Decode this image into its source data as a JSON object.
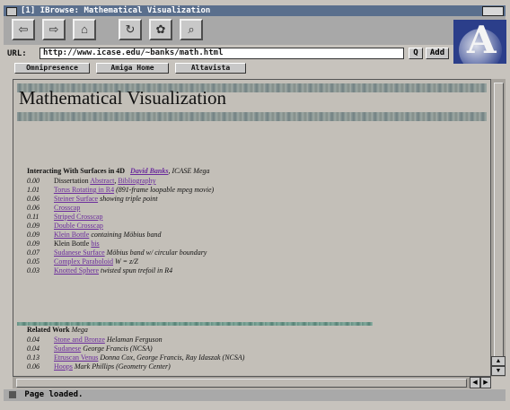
{
  "window": {
    "title": "[1] IBrowse: Mathematical Visualization"
  },
  "toolbar": {
    "buttons": [
      {
        "name": "back-button",
        "label": "⇦",
        "icon": "back-arrow-icon"
      },
      {
        "name": "forward-button",
        "label": "⇨",
        "icon": "forward-arrow-icon"
      },
      {
        "name": "home-button",
        "label": "⌂",
        "icon": "home-icon"
      },
      {
        "name": "reload-button",
        "label": "↻",
        "icon": "reload-icon"
      },
      {
        "name": "images-button",
        "label": "✿",
        "icon": "images-icon"
      },
      {
        "name": "find-button",
        "label": "⌕",
        "icon": "find-icon"
      }
    ]
  },
  "url": {
    "label": "URL:",
    "value": "http://www.icase.edu/~banks/math.html",
    "search_btn": "Q",
    "add_btn": "Add"
  },
  "bookmarks": [
    "Omnipresence",
    "Amiga Home",
    "Altavista"
  ],
  "logo": {
    "letter": "A"
  },
  "page": {
    "heading": "Mathematical Visualization",
    "section1": {
      "title": "Interacting With Surfaces in 4D",
      "author_link": "David Banks",
      "affiliation": ", ICASE",
      "tag": "Mega"
    },
    "entries": [
      {
        "num": "0.00",
        "pre": "Dissertation",
        "links": [
          "Abstract",
          "Bibliography"
        ],
        "desc": ""
      },
      {
        "num": "1.01",
        "pre": "",
        "links": [
          "Torus Rotating in R4"
        ],
        "desc": "(891-frame loopable mpeg movie)"
      },
      {
        "num": "0.06",
        "pre": "",
        "links": [
          "Steiner Surface"
        ],
        "desc": "showing triple point"
      },
      {
        "num": "0.06",
        "pre": "",
        "links": [
          "Crosscap"
        ],
        "desc": ""
      },
      {
        "num": "0.11",
        "pre": "",
        "links": [
          "Striped Crosscap"
        ],
        "desc": ""
      },
      {
        "num": "0.09",
        "pre": "",
        "links": [
          "Double Crosscap"
        ],
        "desc": ""
      },
      {
        "num": "0.09",
        "pre": "",
        "links": [
          "Klein Bottle"
        ],
        "desc": "containing Möbius band"
      },
      {
        "num": "0.09",
        "pre": "Klein Bottle",
        "links": [
          "bis"
        ],
        "desc": ""
      },
      {
        "num": "0.07",
        "pre": "",
        "links": [
          "Sudanese Surface"
        ],
        "desc": "Möbius band w/ circular boundary"
      },
      {
        "num": "0.05",
        "pre": "",
        "links": [
          "Complex Paraboloid"
        ],
        "desc": "W = z/Z"
      },
      {
        "num": "0.03",
        "pre": "",
        "links": [
          "Knotted Sphere"
        ],
        "desc": "twisted spun trefoil in R4"
      }
    ],
    "section2": {
      "title": "Related Work",
      "tag": "Mega"
    },
    "related": [
      {
        "num": "0.04",
        "link": "Stone and Bronze",
        "desc": "Helaman Ferguson"
      },
      {
        "num": "0.04",
        "link": "Sudanese",
        "desc": "George Francis (NCSA)"
      },
      {
        "num": "0.13",
        "link": "Etruscan Venus",
        "desc": "Donna Cox, George Francis, Ray Idaszak (NCSA)"
      },
      {
        "num": "0.06",
        "link": "Hoops",
        "desc": "Mark Phillips (Geometry Center)"
      }
    ]
  },
  "status": {
    "text": "Page loaded."
  }
}
